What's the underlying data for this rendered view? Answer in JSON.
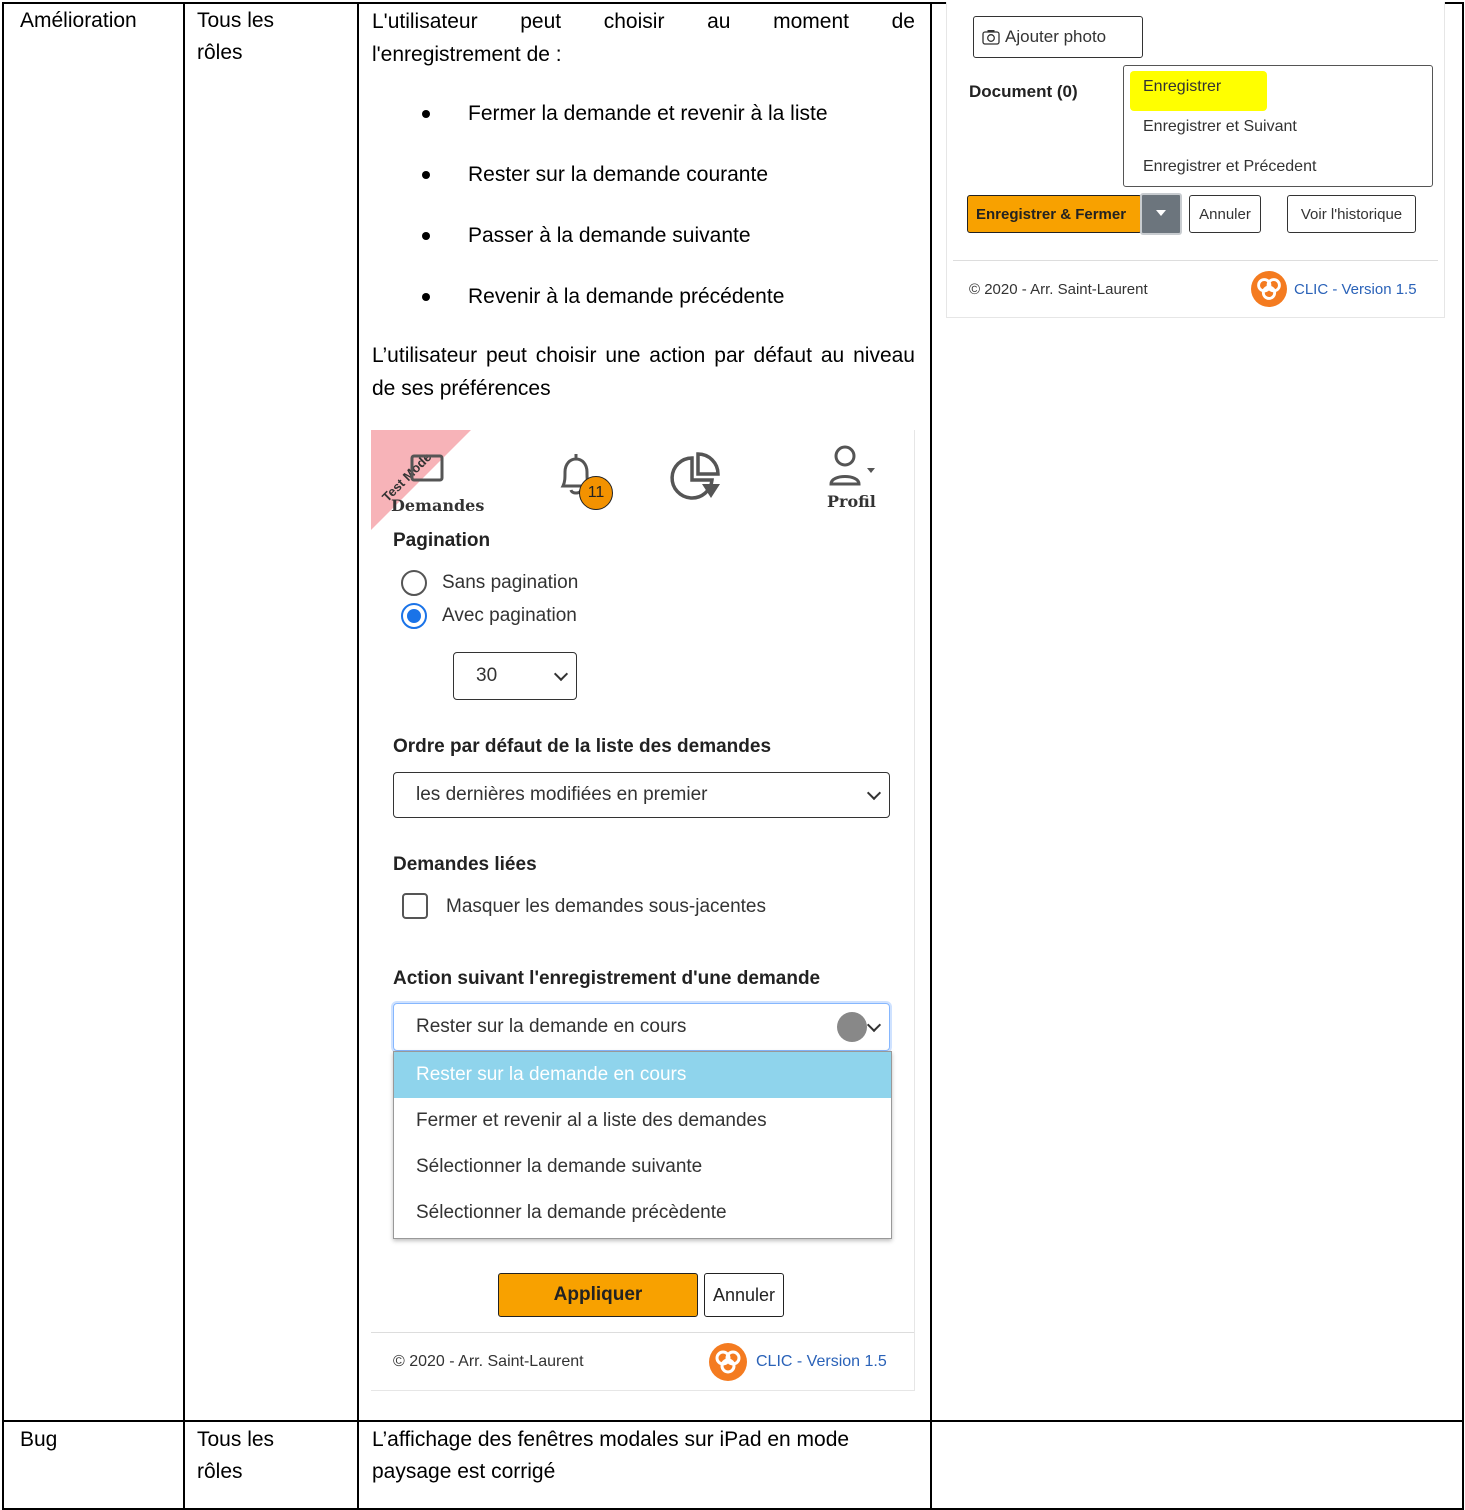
{
  "rows": [
    {
      "type": "Amélioration",
      "roles": "Tous les rôles",
      "intro": "L'utilisateur peut choisir au moment de",
      "intro2": "l'enregistrement de :",
      "bullets": [
        "Fermer la demande et revenir à la liste",
        "Rester sur la demande courante",
        "Passer à la demande suivante",
        "Revenir à la demande précédente"
      ],
      "pref_note": "L’utilisateur peut choisir une action par défaut au niveau de ses préférences"
    },
    {
      "type": "Bug",
      "roles": "Tous les rôles",
      "desc": "L’affichage des fenêtres modales sur iPad en mode paysage est corrigé"
    }
  ],
  "prefs": {
    "ribbon": "Test Mode",
    "nav": {
      "demandes": "Demandes",
      "badge": "11",
      "profil": "Profil"
    },
    "pagination_title": "Pagination",
    "radio_no": "Sans pagination",
    "radio_yes": "Avec pagination",
    "page_size": "30",
    "order_title": "Ordre par défaut de la liste des demandes",
    "order_value": "les dernières modifiées en premier",
    "linked_title": "Demandes liées",
    "linked_checkbox": "Masquer les demandes sous-jacentes",
    "action_title": "Action suivant l'enregistrement d'une demande",
    "action_value": "Rester sur la demande en cours",
    "action_options": [
      "Rester sur la demande en cours",
      "Fermer et revenir al a liste des demandes",
      "Sélectionner la demande suivante",
      "Sélectionner la demande précèdente"
    ],
    "apply": "Appliquer",
    "cancel": "Annuler",
    "footer_left": "© 2020 - Arr. Saint-Laurent",
    "footer_right": "CLIC - Version 1.5"
  },
  "save_ui": {
    "add_photo": "Ajouter photo",
    "document": "Document (0)",
    "menu": [
      "Enregistrer",
      "Enregistrer et Suivant",
      "Enregistrer et Précedent"
    ],
    "save_close": "Enregistrer & Fermer",
    "cancel": "Annuler",
    "history": "Voir l'historique",
    "footer_left": "© 2020 - Arr. Saint-Laurent",
    "footer_right": "CLIC - Version 1.5"
  },
  "colors": {
    "accent_orange": "#f8a100",
    "link_blue": "#2a62b8",
    "highlight_yellow": "#ffff00",
    "dropdown_selected": "#8fd4ec"
  }
}
